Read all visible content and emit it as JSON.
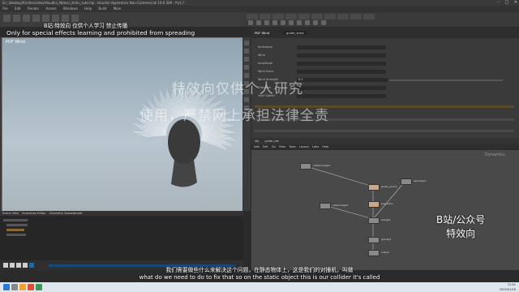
{
  "window": {
    "title": "D:/_Ideabay/Kirsten/video/Houdini_Notes/_zhihu_tuto.hip - Houdini Apprentice Non-Commercial 19.0.589 - Py3.7",
    "minimize": "–",
    "maximize": "□",
    "close": "✕"
  },
  "menubar": {
    "items": [
      "File",
      "Edit",
      "Render",
      "Assets",
      "Windows",
      "Help",
      "Build",
      "Main"
    ]
  },
  "watermarks": {
    "top_zh": "B站:特效向 仅供个人学习 禁止传播",
    "top_en": "Only for special effects learning and prohibited from spreading",
    "mid_line1": "特效向仅供个人研究",
    "mid_line2": "使用，严禁网上承担法律全责",
    "side_line1": "B站/公众号",
    "side_line2": "特效向"
  },
  "viewport": {
    "label": "PDF Wind"
  },
  "timeline": {
    "tabs": [
      "Scene View",
      "Animation Editor",
      "Geometry Spreadsheet"
    ]
  },
  "parameters": {
    "node_label": "PDF Wind",
    "node_name": "guide_wind",
    "fields": [
      {
        "label": "Animation"
      },
      {
        "label": "Wind"
      },
      {
        "label": "Amplitude"
      },
      {
        "label": "Wind Force"
      },
      {
        "label": "Wind Strength",
        "value": "0.1"
      },
      {
        "label": "Direction"
      },
      {
        "label": "Swirl Speed"
      }
    ]
  },
  "network": {
    "tabs": [
      "obj",
      "guide_sim"
    ],
    "path_menu": [
      "Add",
      "Edit",
      "Go",
      "View",
      "Tools",
      "Layout",
      "Labs",
      "Help"
    ],
    "brand": "Dynamics",
    "nodes": [
      {
        "id": "n1",
        "label": "collisionobject",
        "color": "#8a8a8a"
      },
      {
        "id": "n2",
        "label": "guide_groom",
        "color": "#c9a888"
      },
      {
        "id": "n3",
        "label": "skinobject",
        "color": "#8a8a8a"
      },
      {
        "id": "n4",
        "label": "vellumobject",
        "color": "#8a8a8a"
      },
      {
        "id": "n5",
        "label": "pop_wind",
        "color": "#c9a888"
      },
      {
        "id": "n6",
        "label": "merge1",
        "color": "#8a8a8a"
      },
      {
        "id": "n7",
        "label": "gravity1",
        "color": "#8a8a8a"
      },
      {
        "id": "n8",
        "label": "output",
        "color": "#8a8a8a"
      }
    ]
  },
  "subtitles": {
    "zh": "我们需要做些什么来解决这个问题，在静态物体上，这是我们的对撞机，叫做",
    "en": "what do we need to do to fix that so on the static object this is our collider it's called"
  },
  "taskbar": {
    "time": "12:41",
    "date": "2023/01/18"
  },
  "colors": {
    "accent": "#1a4a7a",
    "viewport_bg": "#b9c6cf",
    "network_bg": "#494949"
  }
}
